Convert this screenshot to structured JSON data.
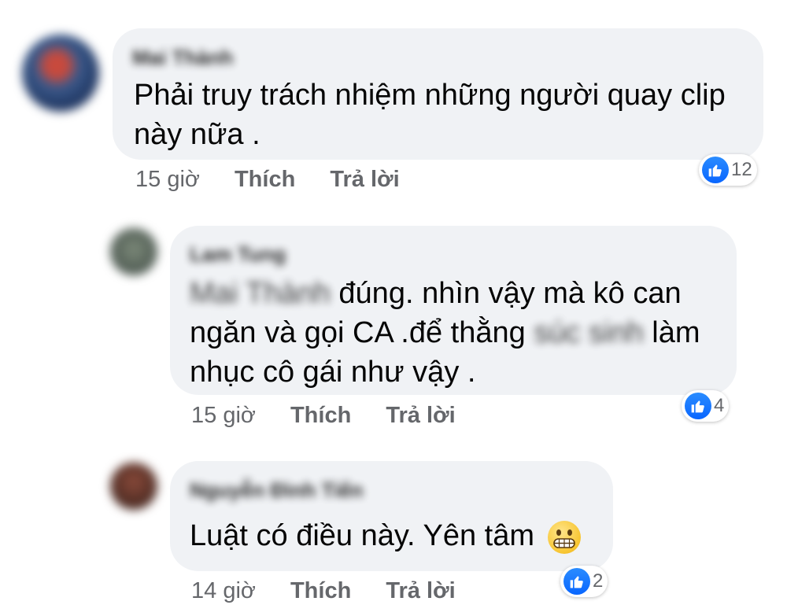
{
  "comments": [
    {
      "author": "Mai Thành",
      "text_lines": [
        "Phải truy trách nhiệm những người quay clip",
        "này nữa ."
      ],
      "time": "15 giờ",
      "like_label": "Thích",
      "reply_label": "Trả lời",
      "reaction_count": "12"
    },
    {
      "author": "Lam Tung",
      "mention": "Mai Thành",
      "text_line1_rest": " đúng.  nhìn vậy mà  kô can",
      "text_line2_start": "ngăn và gọi CA .để thằng ",
      "censored_word": "súc sinh",
      "text_line2_end": " làm",
      "text_line3": "nhục cô gái như vậy  .",
      "time": "15 giờ",
      "like_label": "Thích",
      "reply_label": "Trả lời",
      "reaction_count": "4"
    },
    {
      "author": "Nguyễn Đình Tiến",
      "text": "Luật có điều này. Yên tâm",
      "emoji": "grimacing-face",
      "time": "14 giờ",
      "like_label": "Thích",
      "reply_label": "Trả lời",
      "reaction_count": "2"
    }
  ],
  "colors": {
    "bubble": "#f0f2f5",
    "meta_text": "#65676b",
    "like_blue": "#1877f2"
  }
}
